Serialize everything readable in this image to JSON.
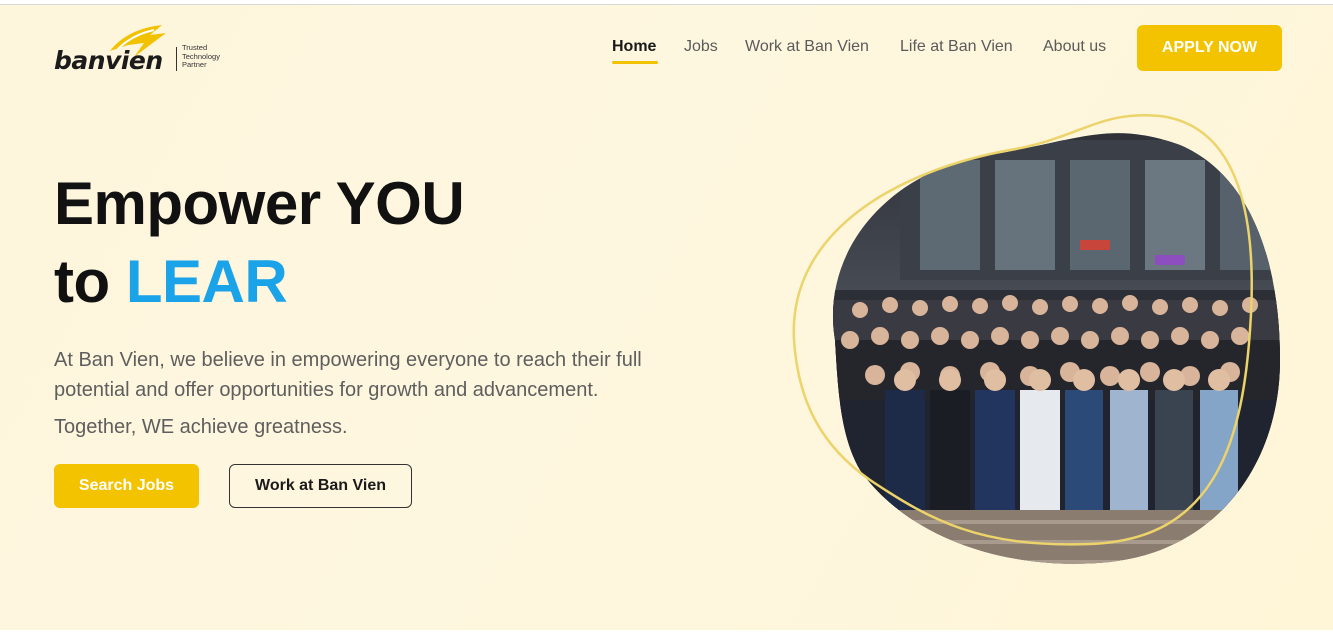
{
  "brand": {
    "name": "banvien",
    "tagline_lines": [
      "Trusted",
      "Technology",
      "Partner"
    ],
    "logo_icon": "lightning-bolt-icon",
    "accent_color": "#f4c300"
  },
  "nav": {
    "items": [
      {
        "label": "Home",
        "active": true
      },
      {
        "label": "Jobs",
        "active": false
      },
      {
        "label": "Work at Ban Vien",
        "active": false
      },
      {
        "label": "Life at Ban Vien",
        "active": false
      },
      {
        "label": "About us",
        "active": false
      }
    ],
    "cta_label": "APPLY NOW"
  },
  "hero": {
    "headline_line1": "Empower YOU",
    "headline_prefix": "to ",
    "headline_accent": "LEAR",
    "accent_color": "#1aa3e8",
    "description": "At Ban Vien, we believe in empowering everyone to reach their full potential and offer opportunities for growth and advancement.",
    "tagline": "Together, WE achieve greatness.",
    "primary_button": "Search Jobs",
    "secondary_button": "Work at Ban Vien",
    "photo_alt": "team-group-photo"
  },
  "colors": {
    "background": "#fdf5dc",
    "heading": "#111111",
    "body_text": "#5e5e5e"
  }
}
